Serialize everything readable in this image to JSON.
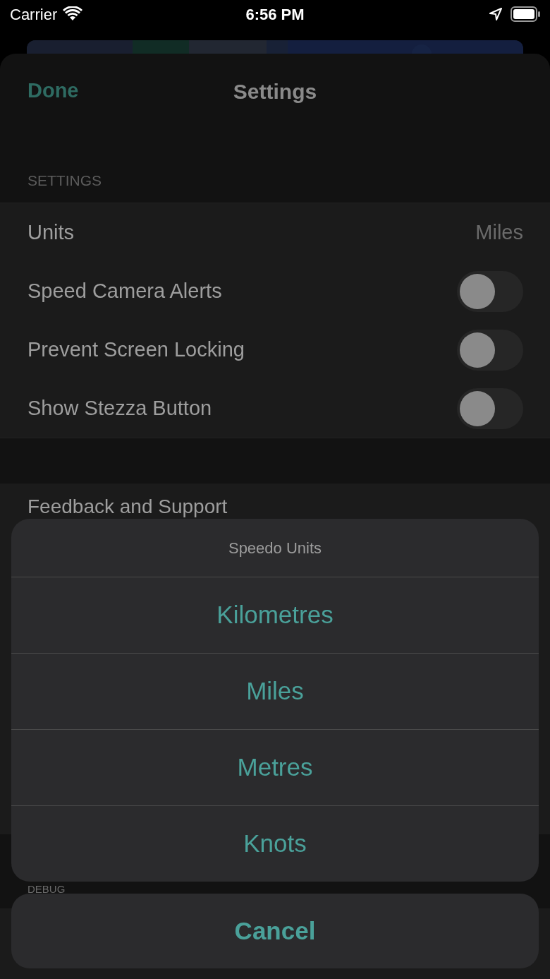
{
  "status_bar": {
    "carrier": "Carrier",
    "time": "6:56 PM"
  },
  "nav": {
    "done": "Done",
    "title": "Settings"
  },
  "settings": {
    "header": "SETTINGS",
    "rows": [
      {
        "kind": "value",
        "label": "Units",
        "value": "Miles"
      },
      {
        "kind": "toggle",
        "label": "Speed Camera Alerts",
        "on": false
      },
      {
        "kind": "toggle",
        "label": "Prevent Screen Locking",
        "on": false
      },
      {
        "kind": "toggle",
        "label": "Show Stezza Button",
        "on": false
      }
    ]
  },
  "support": {
    "rows": [
      {
        "label": "Feedback and Support"
      }
    ]
  },
  "debug": {
    "header": "DEBUG"
  },
  "action_sheet": {
    "title": "Speedo Units",
    "options": [
      "Kilometres",
      "Miles",
      "Metres",
      "Knots"
    ],
    "cancel": "Cancel"
  }
}
